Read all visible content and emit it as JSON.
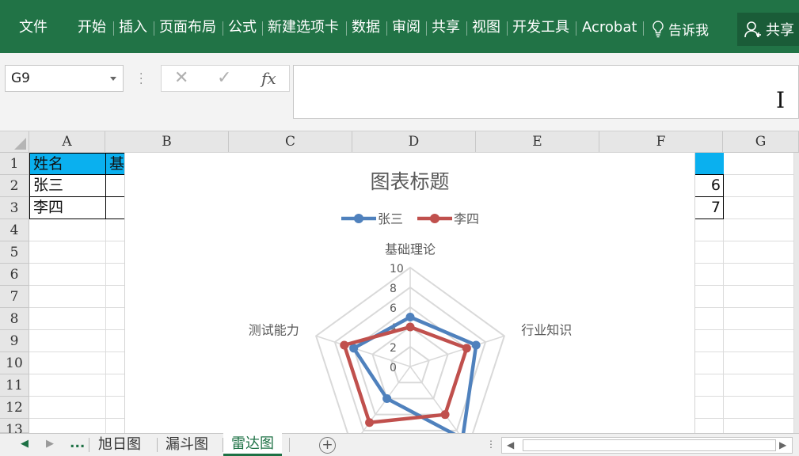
{
  "ribbon": {
    "menus": [
      "文件",
      "开始",
      "插入",
      "页面布局",
      "公式",
      "新建选项卡",
      "数据",
      "审阅",
      "共享",
      "视图",
      "开发工具",
      "Acrobat"
    ],
    "tell_me": "告诉我",
    "share": "共享"
  },
  "formula_bar": {
    "name_box": "G9",
    "fx_label": "fx",
    "formula": ""
  },
  "grid": {
    "columns": [
      "A",
      "B",
      "C",
      "D",
      "E",
      "F",
      "G"
    ],
    "rows": [
      "1",
      "2",
      "3",
      "4",
      "5",
      "6",
      "7",
      "8",
      "9",
      "10",
      "11",
      "12",
      "13"
    ],
    "cells": {
      "A1": "姓名",
      "B1": "基",
      "A2": "张三",
      "A3": "李四",
      "F2": "6",
      "F3": "7"
    }
  },
  "chart_data": {
    "type": "radar",
    "title": "图表标题",
    "categories": [
      "基础理论",
      "行业知识",
      "",
      "",
      "测试能力"
    ],
    "ylim": [
      0,
      10
    ],
    "ticks": [
      "0",
      "2",
      "4",
      "6",
      "8",
      "10"
    ],
    "series": [
      {
        "name": "张三",
        "color": "#4f81bd",
        "values": [
          5,
          7,
          9,
          4,
          6
        ]
      },
      {
        "name": "李四",
        "color": "#c0504d",
        "values": [
          4,
          6,
          6,
          7,
          7
        ]
      }
    ],
    "legend": "top"
  },
  "sheets": {
    "more": "...",
    "tabs": [
      "旭日图",
      "漏斗图",
      "雷达图"
    ],
    "active": "雷达图",
    "add": "+"
  }
}
